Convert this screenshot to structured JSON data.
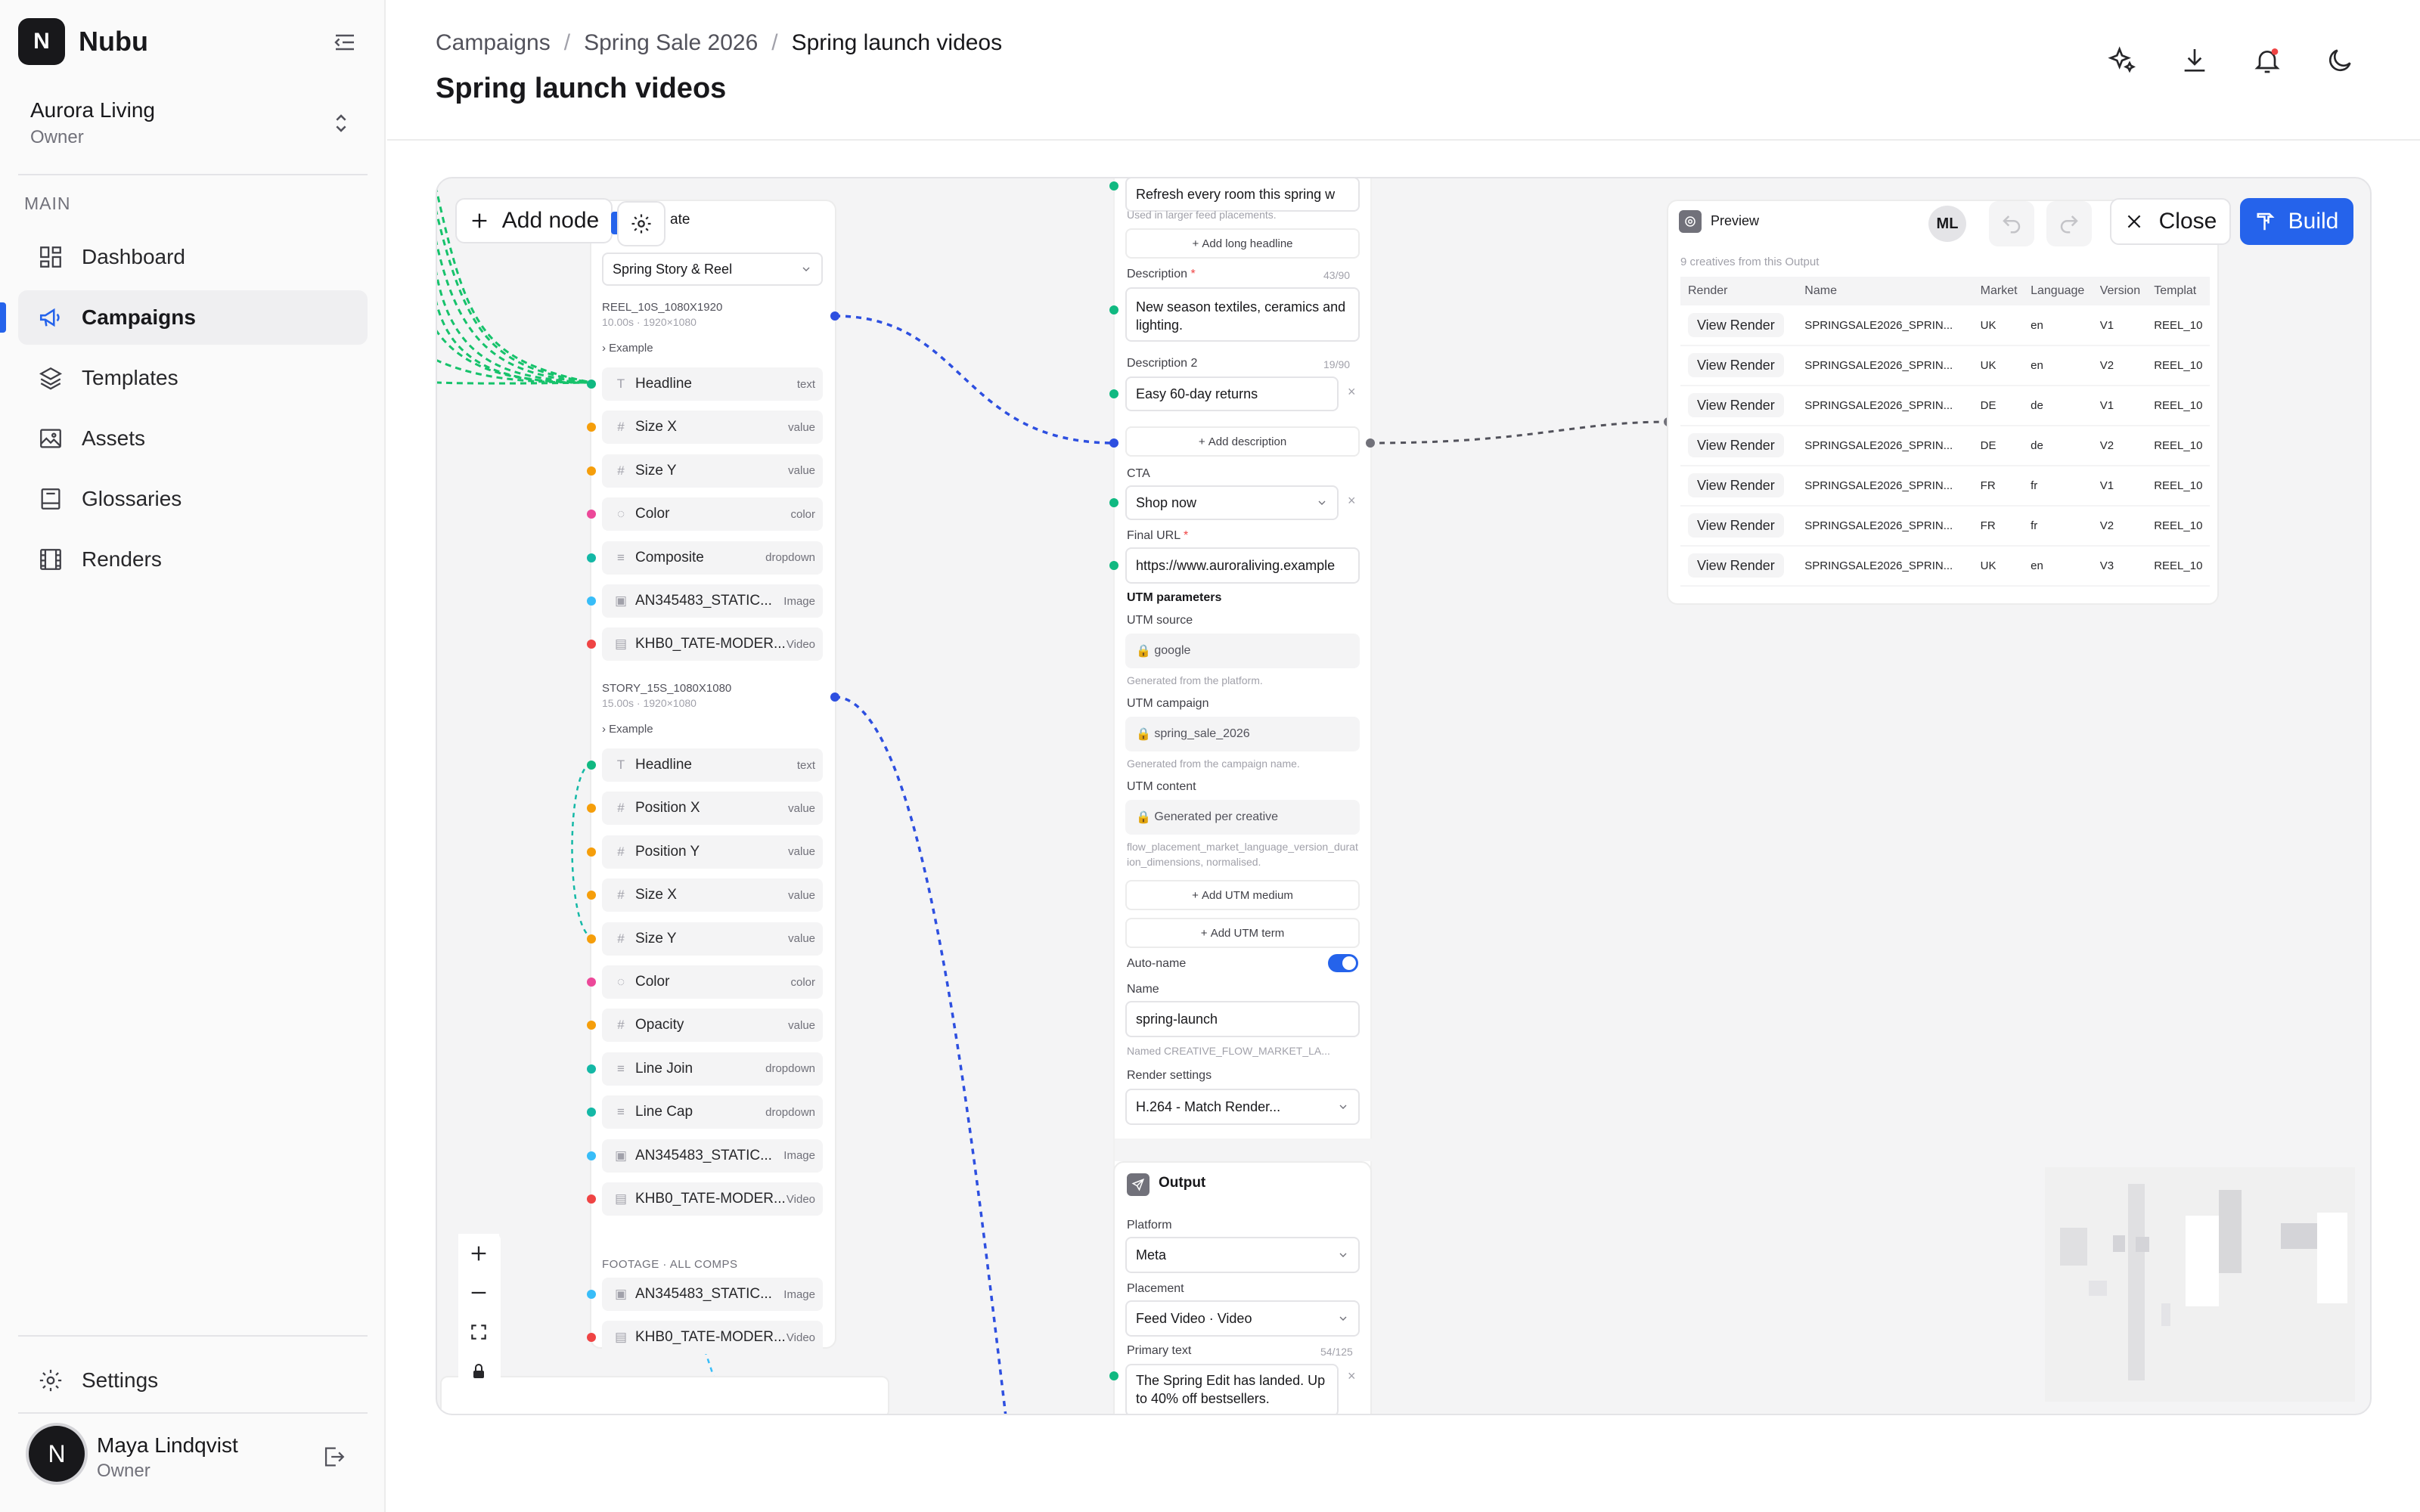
{
  "app": {
    "logo_letter": "N",
    "name": "Nubu"
  },
  "workspace": {
    "name": "Aurora Living",
    "role": "Owner"
  },
  "sidebar": {
    "section": "MAIN",
    "items": [
      {
        "label": "Dashboard",
        "icon": "dashboard-icon"
      },
      {
        "label": "Campaigns",
        "icon": "megaphone-icon"
      },
      {
        "label": "Templates",
        "icon": "layers-icon"
      },
      {
        "label": "Assets",
        "icon": "image-icon"
      },
      {
        "label": "Glossaries",
        "icon": "book-icon"
      },
      {
        "label": "Renders",
        "icon": "film-icon"
      }
    ],
    "settings": "Settings",
    "user": {
      "initial": "N",
      "name": "Maya Lindqvist",
      "role": "Owner"
    }
  },
  "header": {
    "breadcrumb": [
      "Campaigns",
      "Spring Sale 2026",
      "Spring launch videos"
    ],
    "title": "Spring launch videos",
    "icons": [
      "sparkles-icon",
      "download-icon",
      "bell-icon",
      "moon-icon"
    ]
  },
  "toolbar": {
    "add_node": "Add node",
    "close": "Close",
    "build": "Build"
  },
  "template_node": {
    "title_fragment": "ate",
    "select": "Spring Story & Reel",
    "comp1": {
      "name": "REEL_10S_1080X1920",
      "meta": "10.00s · 1920×1080",
      "example": "Example",
      "rows": [
        {
          "label": "Headline",
          "type": "text",
          "icon": "T",
          "dot": "#10b981"
        },
        {
          "label": "Size X",
          "type": "value",
          "icon": "#",
          "dot": "#f59e0b"
        },
        {
          "label": "Size Y",
          "type": "value",
          "icon": "#",
          "dot": "#f59e0b"
        },
        {
          "label": "Color",
          "type": "color",
          "icon": "◌",
          "dot": "#ec4899"
        },
        {
          "label": "Composite",
          "type": "dropdown",
          "icon": "≡",
          "dot": "#14b8a6"
        },
        {
          "label": "AN345483_STATIC...",
          "type": "Image",
          "icon": "▣",
          "dot": "#38bdf8"
        },
        {
          "label": "KHB0_TATE-MODER...",
          "type": "Video",
          "icon": "▤",
          "dot": "#ef4444"
        }
      ]
    },
    "comp2": {
      "name": "STORY_15S_1080X1080",
      "meta": "15.00s · 1920×1080",
      "example": "Example",
      "rows": [
        {
          "label": "Headline",
          "type": "text",
          "icon": "T",
          "dot": "#10b981"
        },
        {
          "label": "Position X",
          "type": "value",
          "icon": "#",
          "dot": "#f59e0b"
        },
        {
          "label": "Position Y",
          "type": "value",
          "icon": "#",
          "dot": "#f59e0b"
        },
        {
          "label": "Size X",
          "type": "value",
          "icon": "#",
          "dot": "#f59e0b"
        },
        {
          "label": "Size Y",
          "type": "value",
          "icon": "#",
          "dot": "#f59e0b"
        },
        {
          "label": "Color",
          "type": "color",
          "icon": "◌",
          "dot": "#ec4899"
        },
        {
          "label": "Opacity",
          "type": "value",
          "icon": "#",
          "dot": "#f59e0b"
        },
        {
          "label": "Line Join",
          "type": "dropdown",
          "icon": "≡",
          "dot": "#14b8a6"
        },
        {
          "label": "Line Cap",
          "type": "dropdown",
          "icon": "≡",
          "dot": "#14b8a6"
        },
        {
          "label": "AN345483_STATIC...",
          "type": "Image",
          "icon": "▣",
          "dot": "#38bdf8"
        },
        {
          "label": "KHB0_TATE-MODER...",
          "type": "Video",
          "icon": "▤",
          "dot": "#ef4444"
        }
      ]
    },
    "footage": {
      "name": "FOOTAGE · ALL COMPS",
      "rows": [
        {
          "label": "AN345483_STATIC...",
          "type": "Image",
          "icon": "▣",
          "dot": "#38bdf8"
        },
        {
          "label": "KHB0_TATE-MODER...",
          "type": "Video",
          "icon": "▤",
          "dot": "#ef4444"
        }
      ]
    }
  },
  "ad_node": {
    "long_headline": "Refresh every room this spring w",
    "long_headline_hint": "Used in larger feed placements.",
    "add_long_headline": "Add long headline",
    "description_label": "Description",
    "description_count": "43/90",
    "description": "New season textiles, ceramics and lighting.",
    "description2_label": "Description 2",
    "description2_count": "19/90",
    "description2": "Easy 60-day returns",
    "add_description": "Add description",
    "cta_label": "CTA",
    "cta": "Shop now",
    "final_url_label": "Final URL",
    "final_url": "https://www.auroraliving.example",
    "utm_heading": "UTM parameters",
    "utm_source_label": "UTM source",
    "utm_source": "google",
    "utm_source_hint": "Generated from the platform.",
    "utm_campaign_label": "UTM campaign",
    "utm_campaign": "spring_sale_2026",
    "utm_campaign_hint": "Generated from the campaign name.",
    "utm_content_label": "UTM content",
    "utm_content": "Generated per creative",
    "utm_content_hint": "flow_placement_market_language_version_duration_dimensions, normalised.",
    "add_utm_medium": "Add UTM medium",
    "add_utm_term": "Add UTM term",
    "auto_name_label": "Auto-name",
    "auto_name_on": true,
    "name_label": "Name",
    "name": "spring-launch",
    "name_hint": "Named CREATIVE_FLOW_MARKET_LA...",
    "render_label": "Render settings",
    "render": "H.264 - Match Render..."
  },
  "output_node": {
    "title": "Output",
    "platform_label": "Platform",
    "platform": "Meta",
    "placement_label": "Placement",
    "placement": "Feed Video · Video",
    "primary_label": "Primary text",
    "primary_count": "54/125",
    "primary": "The Spring Edit has landed. Up to 40% off bestsellers."
  },
  "preview": {
    "title": "Preview",
    "avatar": "ML",
    "summary": "9 creatives from this Output",
    "columns": [
      "Render",
      "Name",
      "Market",
      "Language",
      "Version",
      "Templat"
    ],
    "rows": [
      [
        "View Render",
        "SPRINGSALE2026_SPRIN...",
        "UK",
        "en",
        "V1",
        "REEL_10"
      ],
      [
        "View Render",
        "SPRINGSALE2026_SPRIN...",
        "UK",
        "en",
        "V2",
        "REEL_10"
      ],
      [
        "View Render",
        "SPRINGSALE2026_SPRIN...",
        "DE",
        "de",
        "V1",
        "REEL_10"
      ],
      [
        "View Render",
        "SPRINGSALE2026_SPRIN...",
        "DE",
        "de",
        "V2",
        "REEL_10"
      ],
      [
        "View Render",
        "SPRINGSALE2026_SPRIN...",
        "FR",
        "fr",
        "V1",
        "REEL_10"
      ],
      [
        "View Render",
        "SPRINGSALE2026_SPRIN...",
        "FR",
        "fr",
        "V2",
        "REEL_10"
      ],
      [
        "View Render",
        "SPRINGSALE2026_SPRIN...",
        "UK",
        "en",
        "V3",
        "REEL_10"
      ]
    ]
  },
  "colors": {
    "accent": "#2563eb",
    "edge_blue": "#2d4fe0",
    "edge_green": "#16c26b",
    "edge_gray": "#52525b"
  }
}
